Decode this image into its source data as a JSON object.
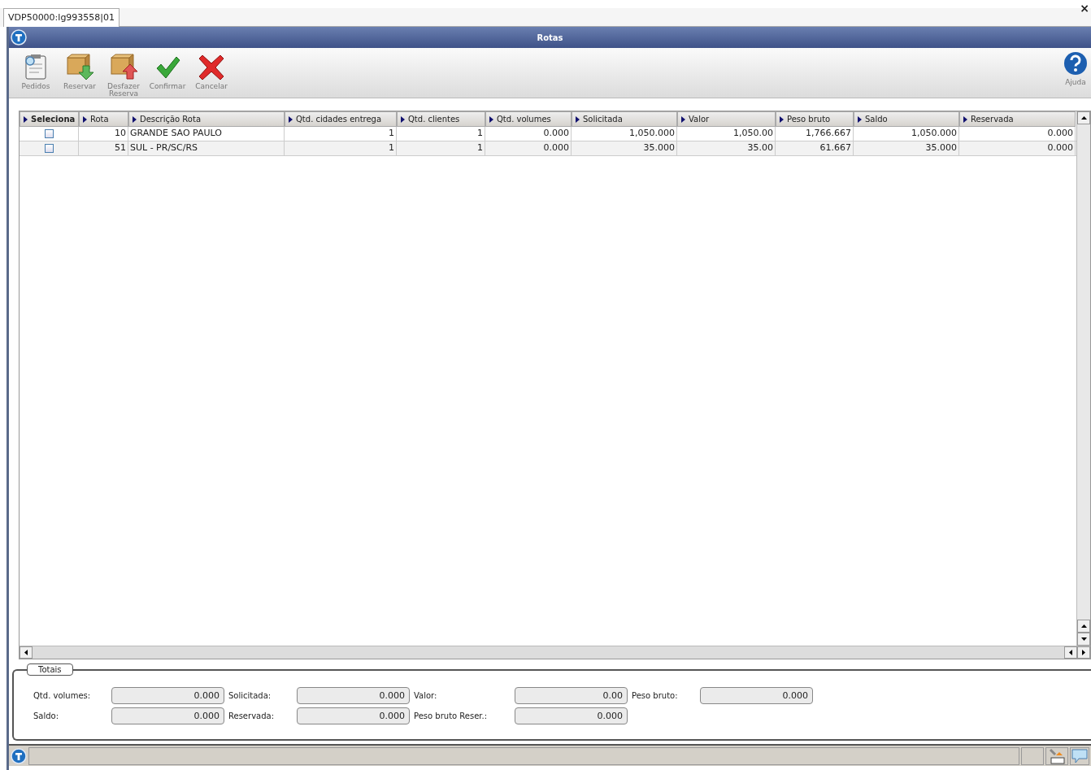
{
  "tab": {
    "label": "VDP50000:lg993558|01",
    "selected": true
  },
  "close_tab": "×",
  "window": {
    "title": "Rotas"
  },
  "toolbar": [
    {
      "kind": "orders",
      "label": "Pedidos"
    },
    {
      "kind": "reserve",
      "label": "Reservar"
    },
    {
      "kind": "unreserve",
      "label": "Desfazer Reserva"
    },
    {
      "kind": "confirm",
      "label": "Confirmar"
    },
    {
      "kind": "cancel",
      "label": "Cancelar"
    }
  ],
  "help": {
    "label": "Ajuda"
  },
  "table": {
    "columns": [
      "Seleciona",
      "Rota",
      "Descrição Rota",
      "Qtd. cidades entrega",
      "Qtd. clientes",
      "Qtd. volumes",
      "Solicitada",
      "Valor",
      "Peso bruto",
      "Saldo",
      "Reservada"
    ],
    "rows": [
      {
        "cells": [
          {
            "checked": false
          },
          "10",
          "GRANDE SAO PAULO",
          "1",
          "1",
          "0.000",
          "1,050.000",
          "1,050.00",
          "1,766.667",
          "1,050.000",
          "0.000"
        ]
      },
      {
        "cells": [
          {
            "checked": false
          },
          "51",
          "SUL - PR/SC/RS",
          "1",
          "1",
          "0.000",
          "35.000",
          "35.00",
          "61.667",
          "35.000",
          "0.000"
        ]
      }
    ]
  },
  "totals": {
    "title": "Totais",
    "fields": [
      {
        "label": "Qtd. volumes:",
        "value": "0.000"
      },
      {
        "label": "Solicitada:",
        "value": "0.000"
      },
      {
        "label": "Valor:",
        "value": "0.00"
      },
      {
        "label": "Peso bruto:",
        "value": "0.000"
      },
      {
        "label": "Saldo:",
        "value": "0.000"
      },
      {
        "label": "Reservada:",
        "value": "0.000"
      },
      {
        "label": "Peso bruto Reser.:",
        "value": "0.000"
      }
    ]
  }
}
